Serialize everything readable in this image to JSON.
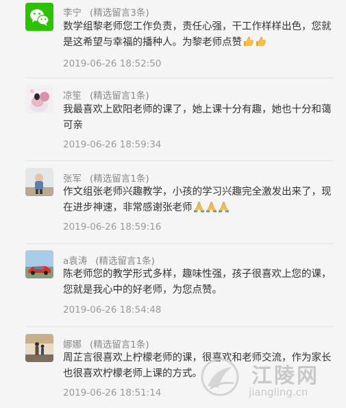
{
  "comments": [
    {
      "name": "李宁",
      "tag": "(精选留言3条)",
      "text": "数学组黎老师您工作负责，责任心强，干工作样样出色，您就是这希望与幸福的播种人。为黎老师点赞",
      "emoji": [
        "thumbs-up",
        "thumbs-up"
      ],
      "time": "2019-06-26 18:52:50",
      "avatar": "wechat-logo"
    },
    {
      "name": "凉笙",
      "tag": "(精选留言1条)",
      "text": "我最喜欢上欧阳老师的课了，她上课十分有趣，她也十分和蔼可亲",
      "emoji": [],
      "time": "2019-06-26 18:59:34",
      "avatar": "photo"
    },
    {
      "name": "张军",
      "tag": "(精选留言1条)",
      "text": "作文组张老师兴趣教学，小孩的学习兴趣完全激发出来了，现在进步神速，非常感谢张老师",
      "emoji": [
        "folded-hands",
        "folded-hands",
        "folded-hands"
      ],
      "time": "2019-06-26 18:59:16",
      "avatar": "photo"
    },
    {
      "name": "a袁涛",
      "tag": "(精选留言1条)",
      "text": "陈老师您的教学形式多样，趣味性强，孩子很喜欢上您的课，您就是我心中的好老师，为您点赞。",
      "emoji": [],
      "time": "2019-06-26 18:54:48",
      "avatar": "photo"
    },
    {
      "name": "娜娜",
      "tag": "(精选留言1条)",
      "text": "周芷言很喜欢上柠檬老师的课，很喜欢和老师交流，作为家长也很喜欢柠檬老师上课的方式。",
      "emoji": [],
      "time": "2019-06-26 18:51:14",
      "avatar": "photo"
    }
  ],
  "watermark": {
    "cn": "江陵网",
    "url": "jiangling.cn"
  },
  "colors": {
    "background": "#f5f5f5",
    "name": "#888888",
    "text": "#333333",
    "time": "#999999",
    "wechat_green": "#2dc100"
  }
}
